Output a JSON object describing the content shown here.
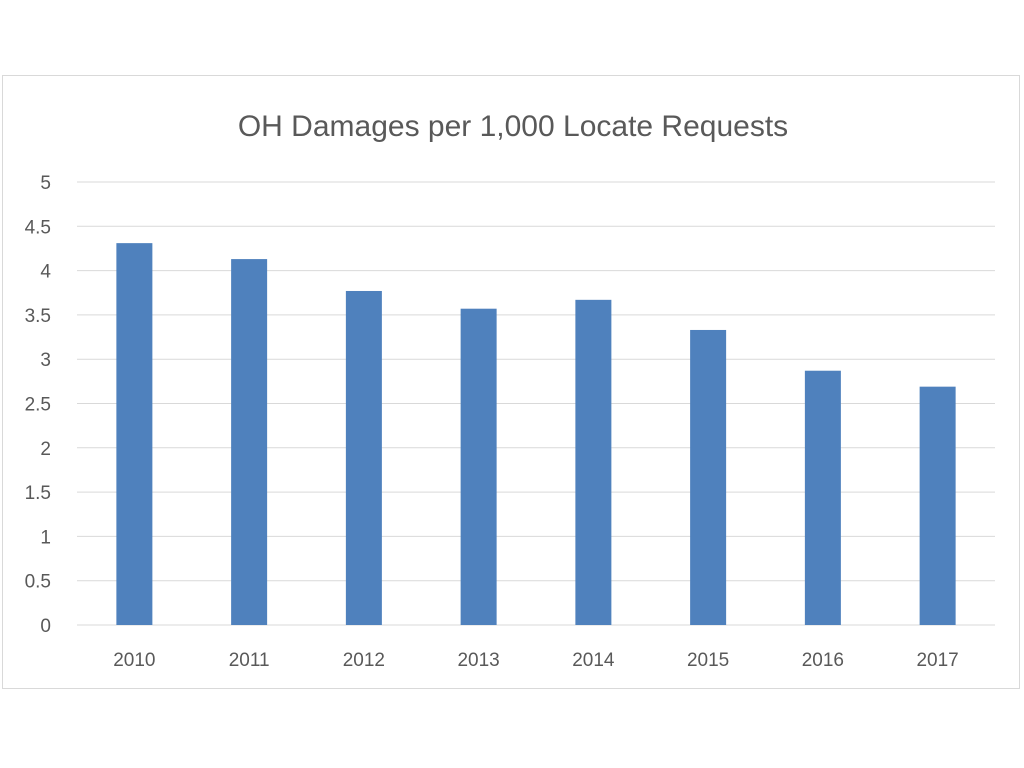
{
  "chart_data": {
    "type": "bar",
    "title": "OH Damages per 1,000 Locate Requests",
    "xlabel": "",
    "ylabel": "",
    "categories": [
      "2010",
      "2011",
      "2012",
      "2013",
      "2014",
      "2015",
      "2016",
      "2017"
    ],
    "series": [
      {
        "values": [
          4.31,
          4.13,
          3.77,
          3.57,
          3.67,
          3.33,
          2.87,
          2.69
        ],
        "color": "#4f81bd"
      }
    ],
    "ylim": [
      0,
      5
    ],
    "yticks": [
      0,
      0.5,
      1,
      1.5,
      2,
      2.5,
      3,
      3.5,
      4,
      4.5,
      5
    ],
    "ytick_labels": [
      "0",
      "0.5",
      "1",
      "1.5",
      "2",
      "2.5",
      "3",
      "3.5",
      "4",
      "4.5",
      "5"
    ],
    "grid": true,
    "legend": "none"
  }
}
